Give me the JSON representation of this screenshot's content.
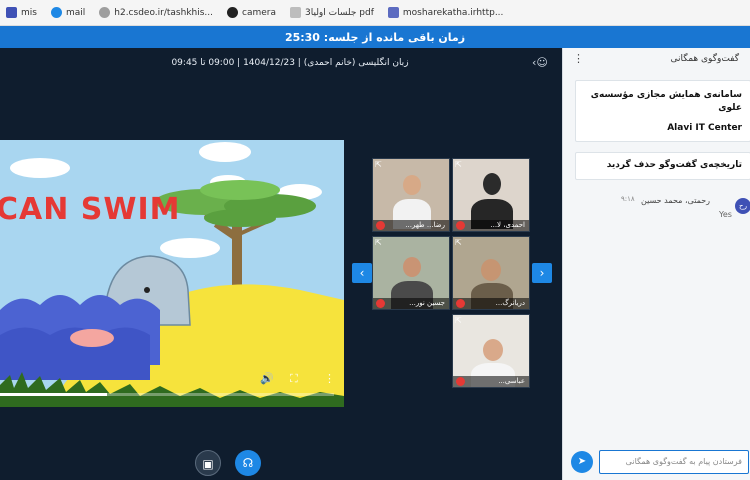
{
  "bookmarks": [
    {
      "label": "mis",
      "icon": "bookmark-icon"
    },
    {
      "label": "mail",
      "icon": "mail-icon"
    },
    {
      "label": "h2.csdeo.ir/tashkhis...",
      "icon": "globe-icon"
    },
    {
      "label": "camera",
      "icon": "camera-icon"
    },
    {
      "label": "جلسات اولیا3 pdf",
      "icon": "pdf-icon"
    },
    {
      "label": "mosharekatha.irhttp...",
      "icon": "site-icon"
    }
  ],
  "timer": {
    "label": "زمان باقی مانده از جلسه:",
    "value": "25:30"
  },
  "meeting": {
    "title": "زبان انگلیسی (خانم احمدی) | 1404/12/23 | 09:00 تا 09:45"
  },
  "video": {
    "overlay_text": "CAN SWIM",
    "progress": 0.32
  },
  "participants": [
    {
      "name": "رضا... طهر..."
    },
    {
      "name": "احمدی، لا..."
    },
    {
      "name": "جسین نور..."
    },
    {
      "name": "دریانرگ..."
    },
    {
      "name": "عباسی..."
    }
  ],
  "controls": {
    "prev": "‹",
    "next": "›"
  },
  "chat": {
    "title": "گفت‌وگوی همگانی",
    "pinned_title": "سامانه‌ی همایش مجازی مؤسسه‌ی علوی",
    "pinned_brand": "Alavi IT Center",
    "system_notice": "تاریخچه‌ی گفت‌وگو حذف گردید",
    "messages": [
      {
        "sender": "رحمتی، محمد حسین",
        "time": "۹:۱۸",
        "text": "Yes",
        "avatar": "رح"
      }
    ],
    "input_placeholder": "فرستادن پیام به گفت‌وگوی همگانی"
  }
}
